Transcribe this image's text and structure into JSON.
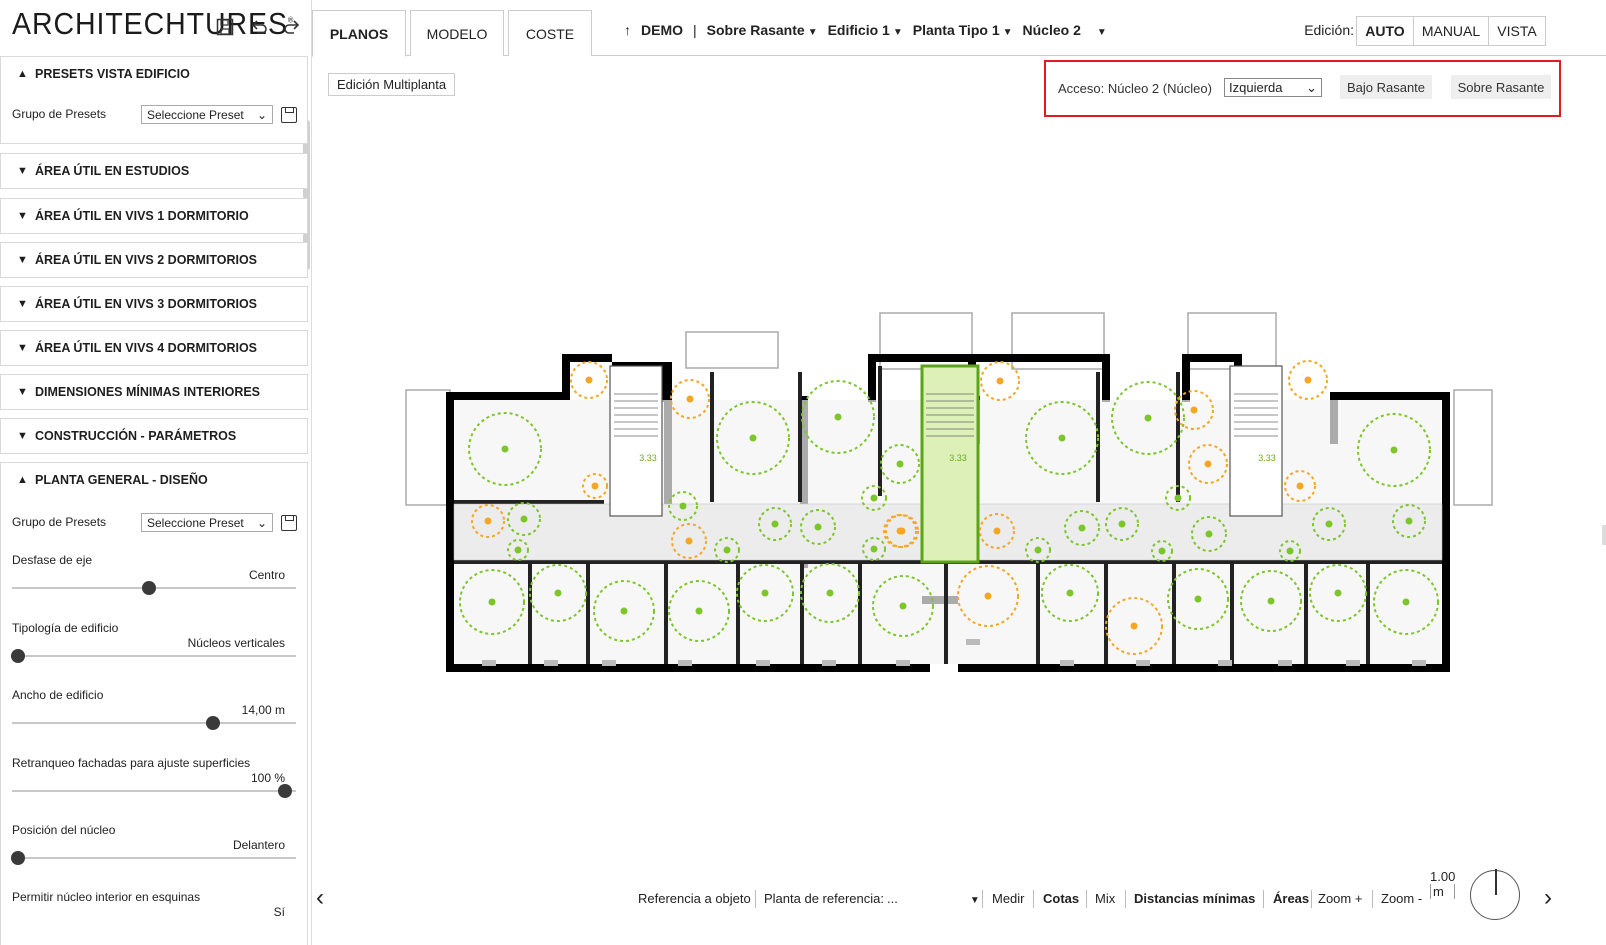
{
  "app": {
    "logo": "ARCHITECHTURES",
    "logo_mark": "®",
    "icons": [
      "save-icon",
      "undo-icon",
      "redo-icon"
    ]
  },
  "tabs": [
    {
      "label": "PLANOS",
      "active": true
    },
    {
      "label": "MODELO",
      "active": false
    },
    {
      "label": "COSTE",
      "active": false
    }
  ],
  "breadcrumb": {
    "up": "↑",
    "project": "DEMO",
    "separator": "|",
    "items": [
      "Sobre Rasante",
      "Edificio 1",
      "Planta Tipo 1",
      "Núcleo 2"
    ]
  },
  "edit_mode": {
    "label": "Edición:",
    "options": [
      {
        "label": "AUTO",
        "active": true
      },
      {
        "label": "MANUAL",
        "active": false
      },
      {
        "label": "VISTA",
        "active": false
      }
    ]
  },
  "sidebar": {
    "presets_section": {
      "title": "PRESETS VISTA EDIFICIO",
      "group_label": "Grupo de Presets",
      "select_value": "Seleccione Preset"
    },
    "collapsed_sections": [
      "ÁREA ÚTIL EN ESTUDIOS",
      "ÁREA ÚTIL EN VIVS 1 DORMITORIO",
      "ÁREA ÚTIL EN VIVS 2 DORMITORIOS",
      "ÁREA ÚTIL EN VIVS 3 DORMITORIOS",
      "ÁREA ÚTIL EN VIVS 4 DORMITORIOS",
      "DIMENSIONES MÍNIMAS INTERIORES",
      "CONSTRUCCIÓN - PARÁMETROS"
    ],
    "planta_section": {
      "title": "PLANTA GENERAL - DISEÑO",
      "group_label": "Grupo de Presets",
      "select_value": "Seleccione Preset",
      "sliders": [
        {
          "label": "Desfase de eje",
          "value": "Centro",
          "level": 0.49
        },
        {
          "label": "Tipología de edificio",
          "value": "Núcleos verticales",
          "level": 0.0
        },
        {
          "label": "Ancho de edificio",
          "value": "14,00 m",
          "level": 0.73
        },
        {
          "label": "Retranqueo fachadas para ajuste superficies",
          "value": "100 %",
          "level": 1.0
        },
        {
          "label": "Posición del núcleo",
          "value": "Delantero",
          "level": 0.0
        }
      ],
      "last_row": {
        "label": "Permitir núcleo interior en esquinas",
        "value": "Sí"
      }
    }
  },
  "main": {
    "multi_floor_button": "Edición Multiplanta",
    "access": {
      "label": "Acceso: Núcleo 2 (Núcleo)",
      "select_value": "Izquierda",
      "below_button": "Bajo Rasante",
      "above_button": "Sobre Rasante"
    },
    "core_labels": [
      "3.33",
      "3.33",
      "3.33"
    ],
    "colors": {
      "accent_red": "#e11b22",
      "circle_green": "#7cc62a",
      "circle_orange": "#f5a623",
      "core_fill": "#dcf0b8"
    }
  },
  "bottom_bar": {
    "left_arrow": "‹",
    "right_arrow": "›",
    "ref_object": "Referencia a objeto",
    "ref_floor_label": "Planta de referencia:",
    "ref_floor_value": "...",
    "measure": "Medir",
    "dims": "Cotas",
    "mix": "Mix",
    "min_dist": "Distancias mínimas",
    "areas": "Áreas",
    "zoom_in": "Zoom +",
    "zoom_out": "Zoom -",
    "scale_value": "1.00",
    "scale_unit": "m"
  }
}
